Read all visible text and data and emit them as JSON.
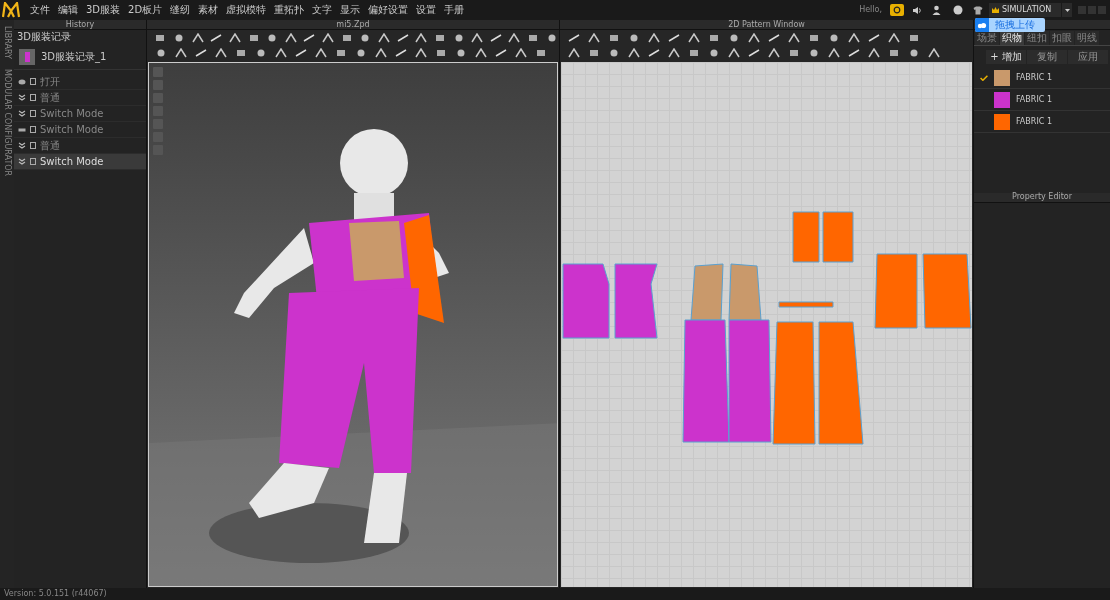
{
  "menu": [
    "文件",
    "编辑",
    "3D服装",
    "2D板片",
    "缝纫",
    "素材",
    "虚拟模特",
    "重拓扑",
    "文字",
    "显示",
    "偏好设置",
    "设置",
    "手册"
  ],
  "top_bar": {
    "greeting": "Hello,",
    "mode": "SIMULATION",
    "upload_tooltip": "拖拽上传"
  },
  "side_strip": [
    "LIBRARY",
    "MODULAR CONFIGURATOR"
  ],
  "history": {
    "title": "History",
    "section": "3D服装记录",
    "snapshot": "3D服装记录_1",
    "items": [
      {
        "kind": "open",
        "label": "打开",
        "selected": false
      },
      {
        "kind": "simulate",
        "label": "普通",
        "selected": false
      },
      {
        "kind": "simulate",
        "label": "Switch Mode",
        "selected": false
      },
      {
        "kind": "mode",
        "label": "Switch Mode",
        "selected": false
      },
      {
        "kind": "simulate",
        "label": "普通",
        "selected": false
      },
      {
        "kind": "simulate",
        "label": "Switch Mode",
        "selected": true
      }
    ]
  },
  "viewport_3d": {
    "title": "mi5.Zpd"
  },
  "pattern_window": {
    "title": "2D Pattern Window"
  },
  "object_browser": {
    "tabs": [
      {
        "label": "场景",
        "selected": false
      },
      {
        "label": "织物",
        "selected": true
      },
      {
        "label": "纽扣",
        "selected": false
      },
      {
        "label": "扣眼",
        "selected": false
      },
      {
        "label": "明线",
        "selected": false
      }
    ],
    "buttons": [
      "+ 增加",
      "复制",
      "应用"
    ],
    "fabrics": [
      {
        "name": "FABRIC 1",
        "color": "#c9996b",
        "checked": true
      },
      {
        "name": "FABRIC 1",
        "color": "#cc33cc",
        "checked": false
      },
      {
        "name": "FABRIC 1",
        "color": "#ff6600",
        "checked": false
      }
    ]
  },
  "property_editor": {
    "title": "Property Editor"
  },
  "status_bar": {
    "version": "Version: 5.0.151 (r44067)"
  }
}
